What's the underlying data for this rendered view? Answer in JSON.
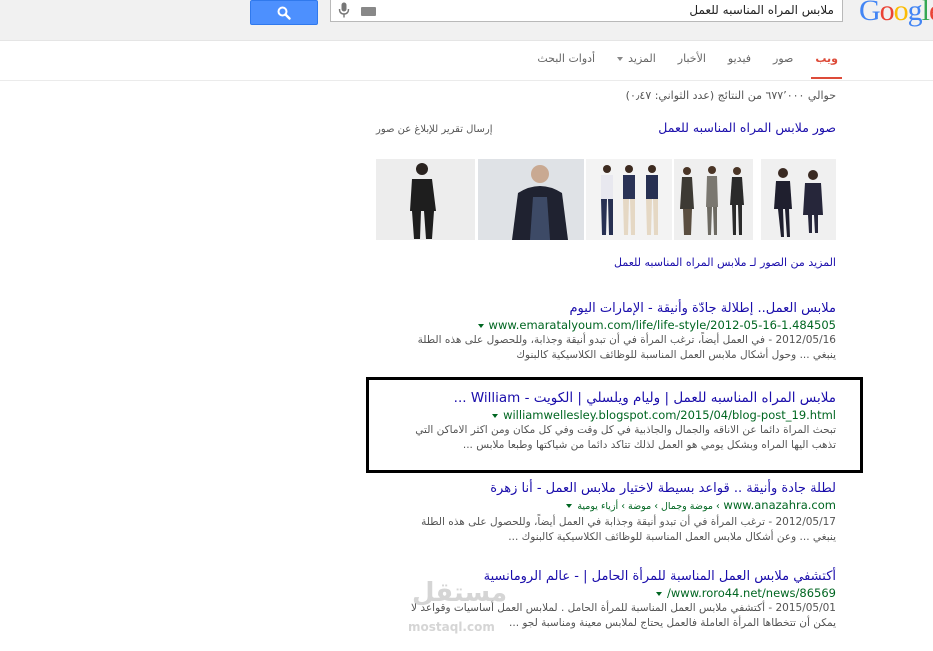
{
  "search": {
    "query": "ملابس المراه المناسبه للعمل"
  },
  "logo": {
    "text": "Google"
  },
  "tabs": [
    {
      "label": "ويب",
      "active": true
    },
    {
      "label": "صور"
    },
    {
      "label": "فيديو"
    },
    {
      "label": "الأخبار"
    },
    {
      "label": "المزيد"
    },
    {
      "label": "أدوات البحث"
    }
  ],
  "stats": "حوالي ٦٧٧٬٠٠٠ من النتائج (عدد الثواني: ٠٫٤٧)",
  "images": {
    "heading": "صور ملابس المراه المناسبه للعمل",
    "report": "إرسال تقرير للإبلاغ عن صور",
    "more": "المزيد من الصور لـ ملابس المراه المناسبه للعمل"
  },
  "results": [
    {
      "title": "ملابس العمل.. إطلالة جادّة وأنيقة - الإمارات اليوم",
      "url": "www.emaratalyoum.com/life/life-style/2012-05-16-1.484505",
      "snippet_lines": [
        "2012/05/16 - في العمل أيضاً، ترغب المرأة في أن تبدو أنيقة وجذابة، وللحصول على هذه الطلة",
        "ينبغي ... وحول أشكال ملابس العمل المناسبة للوظائف الكلاسيكية كالبنوك"
      ]
    },
    {
      "title": "ملابس المراه المناسبه للعمل | وليام ويلسلي | الكويت - William ...",
      "url": "williamwellesley.blogspot.com/2015/04/blog-post_19.html",
      "snippet_lines": [
        "تبحث المراة دائما عن الاناقه والجمال والجاذبية في كل وقت وفي كل مكان ومن اكثر الاماكن التي",
        "تذهب اليها المراه وبشكل يومي هو العمل لذلك تتاكد دائما من شياكتها وطبعا ملابس ..."
      ]
    },
    {
      "title": "لطلة جادة وأنيقة .. قواعد بسيطة لاختيار ملابس العمل - أنا زهرة",
      "url": "www.anazahra.com",
      "breadcrumb": "› موضة وجمال › موضة › أزياء يومية",
      "snippet_lines": [
        "2012/05/17 - ترغب المرأة في أن تبدو أنيقة وجذابة في العمل أيضاً، وللحصول على هذه الطلة",
        "ينبغي ... وعن أشكال ملابس العمل المناسبة للوظائف الكلاسيكية كالبنوك ..."
      ]
    },
    {
      "title": "أكتشفي ملابس العمل المناسبة للمرأة الحامل | - عالم الرومانسية",
      "url": "www.roro44.net/news/86569/",
      "snippet_lines": [
        "2015/05/01 - أكتشفي ملابس العمل المناسبة للمرأة الحامل . لملابس العمل أساسيات وقواعد لا",
        "يمكن أن تتخطاها المرأة العاملة فالعمل يحتاج لملابس معينة ومناسبة لجو ..."
      ]
    }
  ],
  "watermark": {
    "arabic": "مستقل",
    "latin": "mostaql.com"
  }
}
